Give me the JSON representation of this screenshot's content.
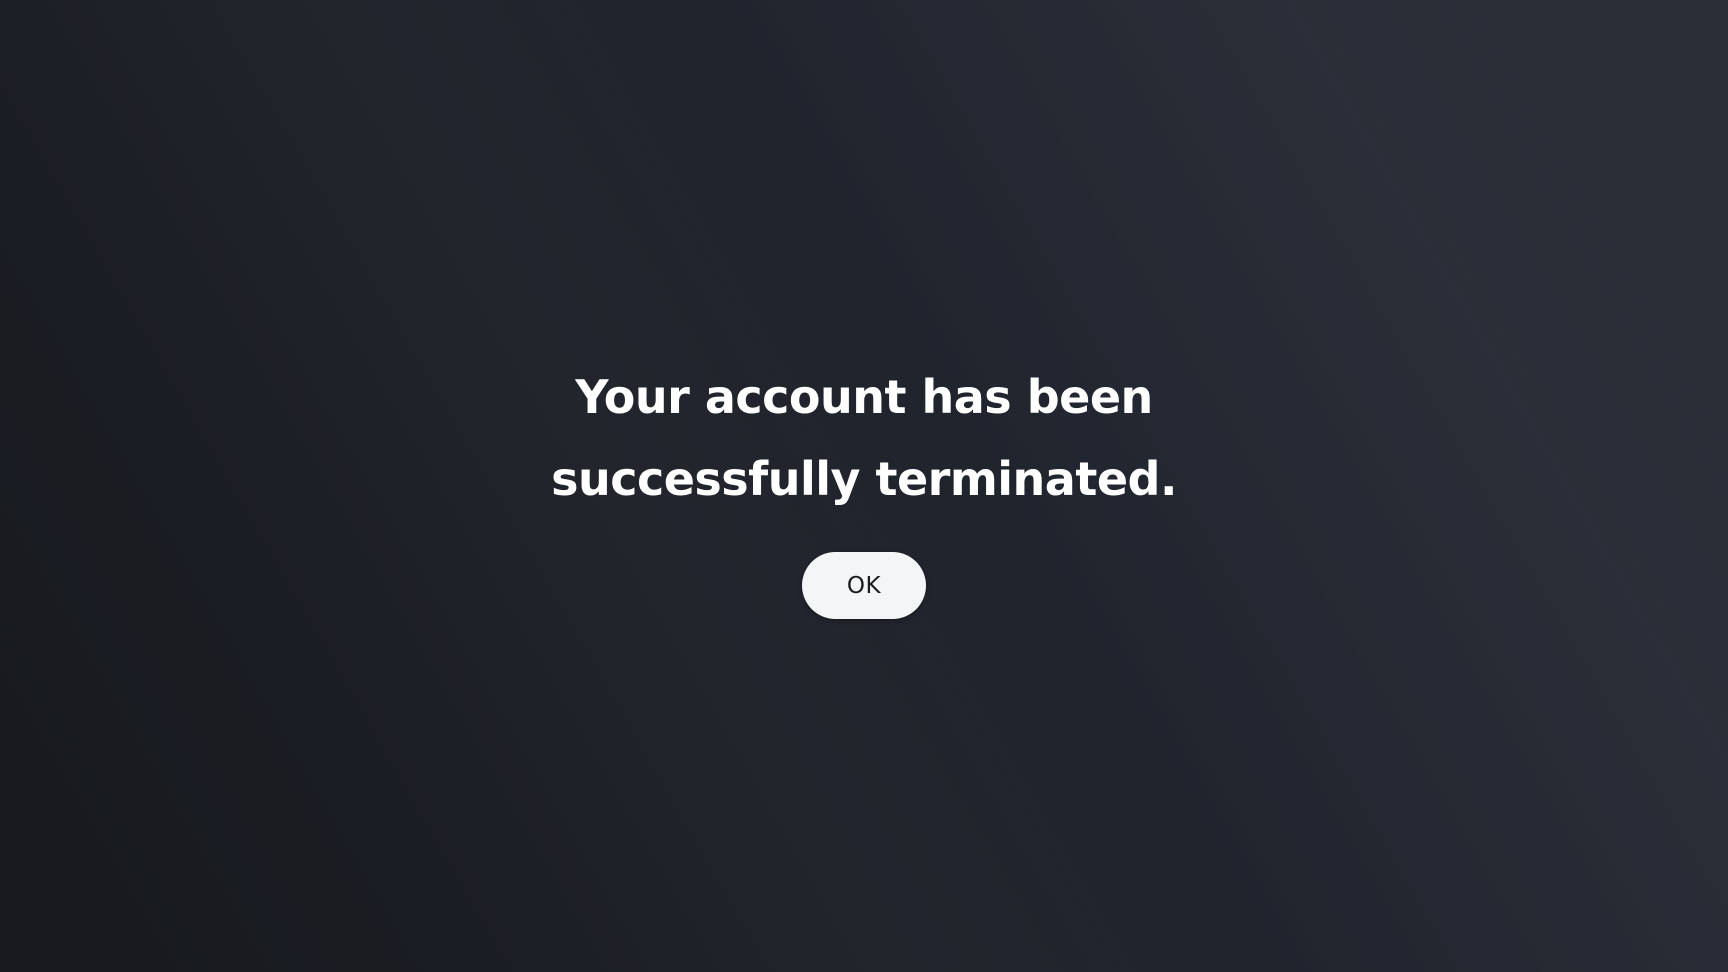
{
  "dialog": {
    "message_line_1": "Your account has been",
    "message_line_2": "successfully terminated.",
    "ok_label": "OK"
  },
  "colors": {
    "background_dark": "#17191e",
    "background_light": "#2a2e37",
    "text": "#ffffff",
    "button_bg": "#f4f5f7",
    "button_text": "#1a1c21"
  }
}
